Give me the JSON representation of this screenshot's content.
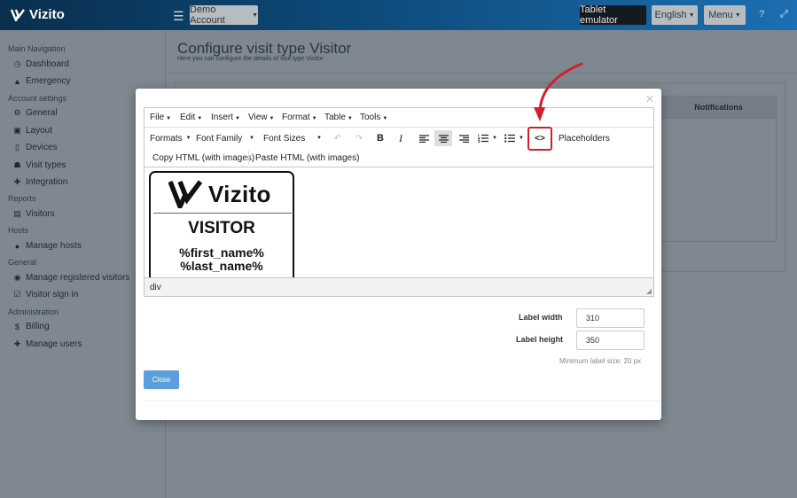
{
  "app": {
    "name": "Vizito"
  },
  "topbar": {
    "account_label": "Demo Account",
    "tablet_label": "Tablet emulator",
    "language_label": "English",
    "menu_label": "Menu",
    "help_icon": "?",
    "expand_icon": "⤢"
  },
  "sidebar": {
    "sections": [
      {
        "title": "Main Navigation",
        "items": [
          {
            "label": "Dashboard",
            "icon": "dashboard-icon"
          },
          {
            "label": "Emergency",
            "icon": "warning-icon"
          }
        ]
      },
      {
        "title": "Account settings",
        "items": [
          {
            "label": "General",
            "icon": "gear-icon"
          },
          {
            "label": "Layout",
            "icon": "image-icon"
          },
          {
            "label": "Devices",
            "icon": "tablet-icon"
          },
          {
            "label": "Visit types",
            "icon": "users-icon"
          },
          {
            "label": "Integration",
            "icon": "puzzle-icon"
          }
        ]
      },
      {
        "title": "Reports",
        "items": [
          {
            "label": "Visitors",
            "icon": "book-icon"
          }
        ]
      },
      {
        "title": "Hosts",
        "items": [
          {
            "label": "Manage hosts",
            "icon": "user-icon"
          }
        ]
      },
      {
        "title": "General",
        "items": [
          {
            "label": "Manage registered visitors",
            "icon": "user-circle-icon"
          },
          {
            "label": "Visitor sign in",
            "icon": "checkbox-icon"
          }
        ]
      },
      {
        "title": "Administration",
        "items": [
          {
            "label": "Billing",
            "icon": "dollar-icon"
          },
          {
            "label": "Manage users",
            "icon": "user-plus-icon"
          }
        ]
      }
    ]
  },
  "page": {
    "title": "Configure visit type Visitor",
    "subtitle": "Here you can configure the details of visit type Visitor",
    "notifications_header": "Notifications"
  },
  "modal": {
    "close_symbol": "×",
    "editor": {
      "menubar": [
        "File",
        "Edit",
        "Insert",
        "View",
        "Format",
        "Table",
        "Tools"
      ],
      "toolbar": {
        "formats": "Formats",
        "font_family": "Font Family",
        "font_sizes": "Font Sizes",
        "source_code_symbol": "<>",
        "placeholders": "Placeholders"
      },
      "toolbar2": {
        "copy_html": "Copy HTML (with images)",
        "paste_html": "Paste HTML (with images)"
      },
      "content": {
        "logo_text": "Vizito",
        "heading": "VISITOR",
        "line1": "%first_name%",
        "line2": "%last_name%"
      },
      "status_path": "div"
    },
    "form": {
      "label_width_label": "Label width",
      "label_width_value": "310",
      "label_height_label": "Label height",
      "label_height_value": "350",
      "hint": "Minimum label size: 20 px"
    },
    "close_label": "Close"
  },
  "colors": {
    "topbar_start": "#0a2f4e",
    "topbar_end": "#1c6fb1",
    "overlay": "#7f8790",
    "primary_button": "#5a9fdb",
    "annotation": "#d2202a"
  }
}
